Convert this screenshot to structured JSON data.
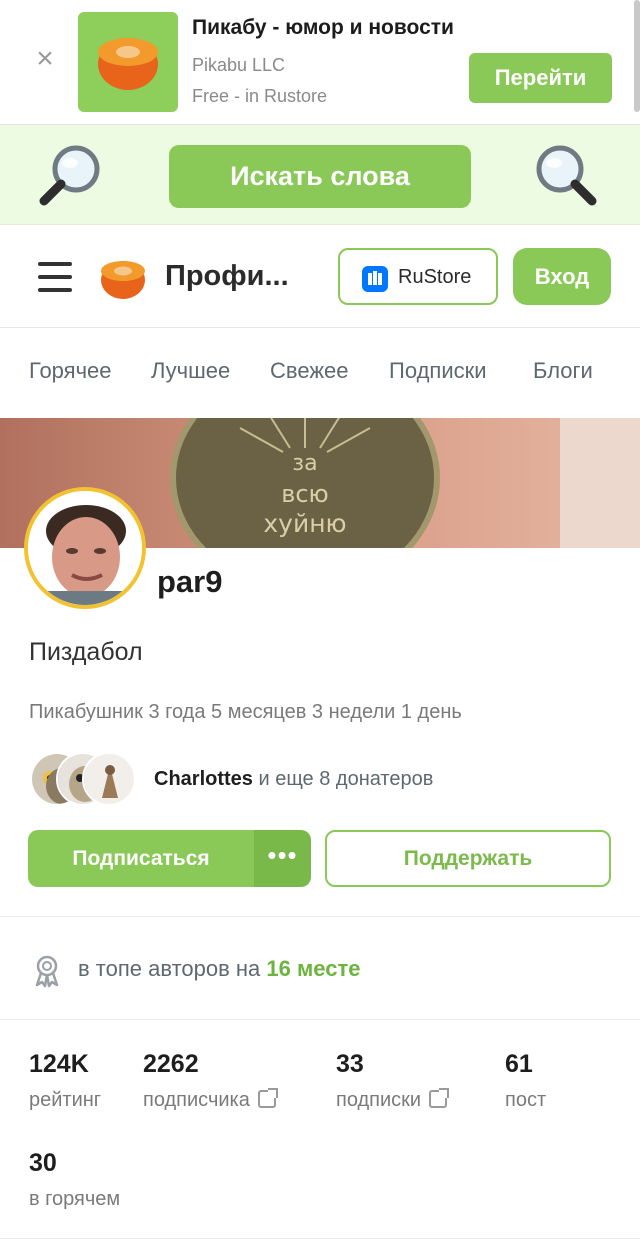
{
  "app_banner": {
    "close_label": "×",
    "app_name": "Пикабу - юмор и новости",
    "developer": "Pikabu LLC",
    "price": "Free - in Rustore",
    "action_label": "Перейти"
  },
  "search_strip": {
    "button_label": "Искать слова",
    "left_icon": "magnifier-icon",
    "right_icon": "magnifier-icon"
  },
  "header": {
    "title": "Профи...",
    "rustore_label": "RuStore",
    "login_label": "Вход"
  },
  "nav": {
    "tabs": [
      {
        "label": "Горячее"
      },
      {
        "label": "Лучшее"
      },
      {
        "label": "Свежее"
      },
      {
        "label": "Подписки"
      },
      {
        "label": "Блоги"
      }
    ]
  },
  "profile": {
    "cover_text": [
      "за",
      "всю",
      "хуйню"
    ],
    "username": "par9",
    "status": "Пиздабол",
    "membership": "Пикабушник 3 года 5 месяцев 3 недели 1 день",
    "donors_name": "Charlottes",
    "donors_rest": " и еще 8 донатеров",
    "subscribe_label": "Подписаться",
    "more_label": "•••",
    "support_label": "Поддержать"
  },
  "top_authors": {
    "prefix": "в топе авторов на ",
    "rank": "16 месте"
  },
  "stats": [
    {
      "value": "124K",
      "label": "рейтинг",
      "external": false
    },
    {
      "value": "2262",
      "label": "подписчика",
      "external": true
    },
    {
      "value": "33",
      "label": "подписки",
      "external": true
    },
    {
      "value": "61",
      "label": "пост",
      "external": false
    },
    {
      "value": "30",
      "label": "в горячем",
      "external": false
    }
  ],
  "colors": {
    "accent": "#8ac858",
    "accent_dark": "#79b94a",
    "strip_bg": "#eefbe3",
    "avatar_ring": "#f2c230",
    "rustore_blue": "#0077ff"
  }
}
